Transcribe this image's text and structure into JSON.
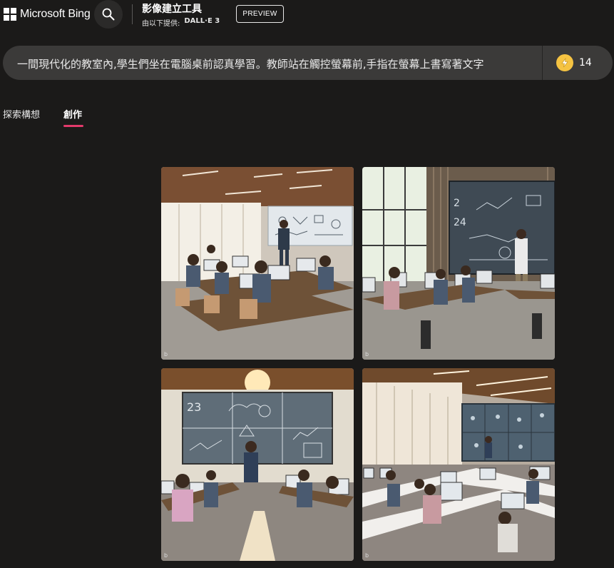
{
  "header": {
    "brand": "Microsoft Bing",
    "app_title": "影像建立工具",
    "provider_prefix": "由以下提供:",
    "provider_model": "DALL·E 3",
    "preview_label": "PREVIEW"
  },
  "prompt": {
    "text": "一間現代化的教室內,學生們坐在電腦桌前認真學習。教師站在觸控螢幕前,手指在螢幕上書寫著文字",
    "boosts": "14"
  },
  "tabs": [
    {
      "label": "探索構想",
      "active": false
    },
    {
      "label": "創作",
      "active": true
    }
  ],
  "images": [
    {
      "name": "generated-image-1",
      "badge": "b"
    },
    {
      "name": "generated-image-2",
      "badge": "b"
    },
    {
      "name": "generated-image-3",
      "badge": "b"
    },
    {
      "name": "generated-image-4",
      "badge": "b"
    }
  ],
  "icons": {
    "logo": "microsoft-logo-icon",
    "search": "search-icon",
    "boost": "lightning-icon"
  },
  "colors": {
    "background": "#1b1a19",
    "prompt_bar": "#3b3a39",
    "tab_underline": "#e33a6b",
    "boost_coin": "#f5c342"
  }
}
